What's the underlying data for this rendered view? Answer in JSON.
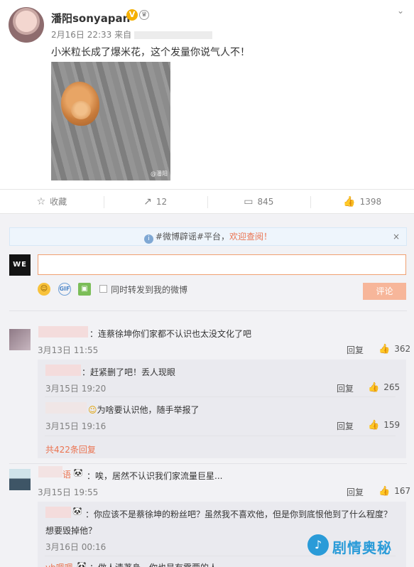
{
  "post": {
    "username": "潘阳sonyapan",
    "verified_badge": "V",
    "medal_icon": "medal-icon",
    "time": "2月16日 22:33",
    "source_prefix": "来自",
    "text": "小米粒长成了爆米花，这个发量你说气人不！",
    "photo_watermark": "@潘阳",
    "menu_icon": "chevron-down-icon"
  },
  "actions": {
    "favorite": {
      "icon": "star-icon",
      "label": "收藏"
    },
    "repost": {
      "icon": "share-icon",
      "count": "12"
    },
    "comment": {
      "icon": "comment-icon",
      "count": "845"
    },
    "like": {
      "icon": "thumbs-up-icon",
      "count": "1398"
    }
  },
  "notice": {
    "text": "#微博辟谣#平台，",
    "link": "欢迎查阅！",
    "close": "×"
  },
  "composer": {
    "avatar_text": "WE",
    "forward_label": "同时转发到我的微博",
    "submit_label": "评论",
    "tools": [
      "emoji-icon",
      "gif-icon",
      "image-icon"
    ]
  },
  "comments": [
    {
      "text": "：连蔡徐坤你们家都不认识也太没文化了吧",
      "time": "3月13日 11:55",
      "reply": "回复",
      "likes": "362",
      "replies": [
        {
          "text": "：赶紧删了吧！丢人现眼",
          "time": "3月15日 19:20",
          "reply": "回复",
          "likes": "265"
        },
        {
          "text": "为啥要认识他，随手举报了",
          "time": "3月15日 19:16",
          "reply": "回复",
          "likes": "159"
        }
      ],
      "more": "共422条回复"
    },
    {
      "name_suffix": "语",
      "text": "：唉，居然不认识我们家流量巨星...",
      "time": "3月15日 19:55",
      "reply": "回复",
      "likes": "167",
      "replies": [
        {
          "text": "：你应该不是蔡徐坤的粉丝吧？虽然我不喜欢他，但是你到底恨他到了什么程度？",
          "text2": "想要毁掉他？",
          "time": "3月16日 00:16"
        }
      ]
    }
  ],
  "last_partial": {
    "name": "yb嗯嗯",
    "text": "：做人清著身，你也是有需要的人"
  },
  "brand_logo": {
    "text": "剧情奥秘",
    "color": "#2a9bd8"
  }
}
